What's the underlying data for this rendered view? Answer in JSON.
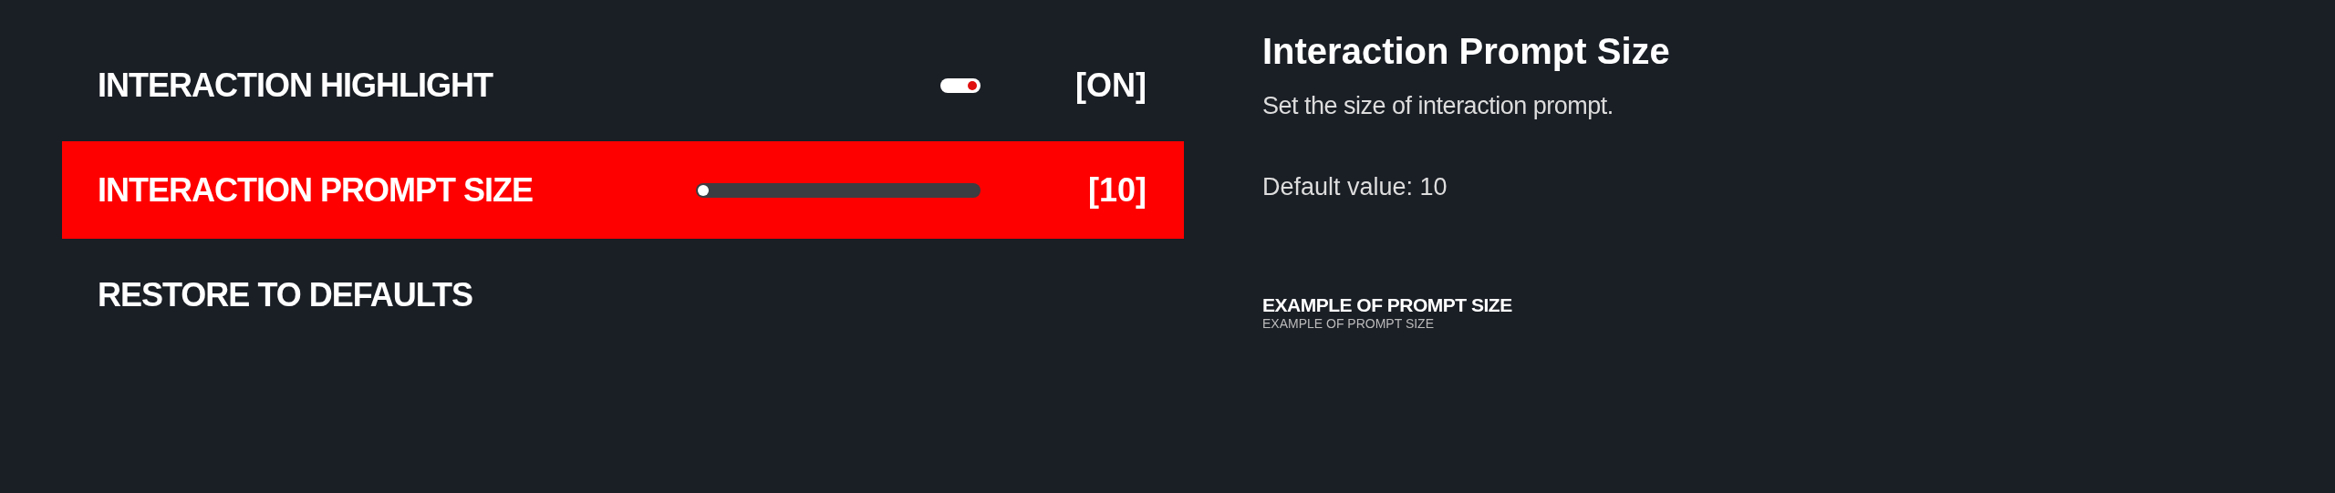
{
  "settings": [
    {
      "kind": "toggle",
      "label": "INTERACTION HIGHLIGHT",
      "on": true,
      "value": "[ON]",
      "selected": false
    },
    {
      "kind": "slider",
      "label": "INTERACTION PROMPT SIZE",
      "level": 0,
      "value": "[10]",
      "selected": true
    },
    {
      "kind": "action",
      "label": "RESTORE TO DEFAULTS",
      "selected": false
    }
  ],
  "details": {
    "title": "Interaction Prompt Size",
    "description": "Set the size of interaction prompt.",
    "default_value": "Default value: 10",
    "example_large": "EXAMPLE OF PROMPT SIZE",
    "example_small": "EXAMPLE OF PROMPT SIZE"
  }
}
